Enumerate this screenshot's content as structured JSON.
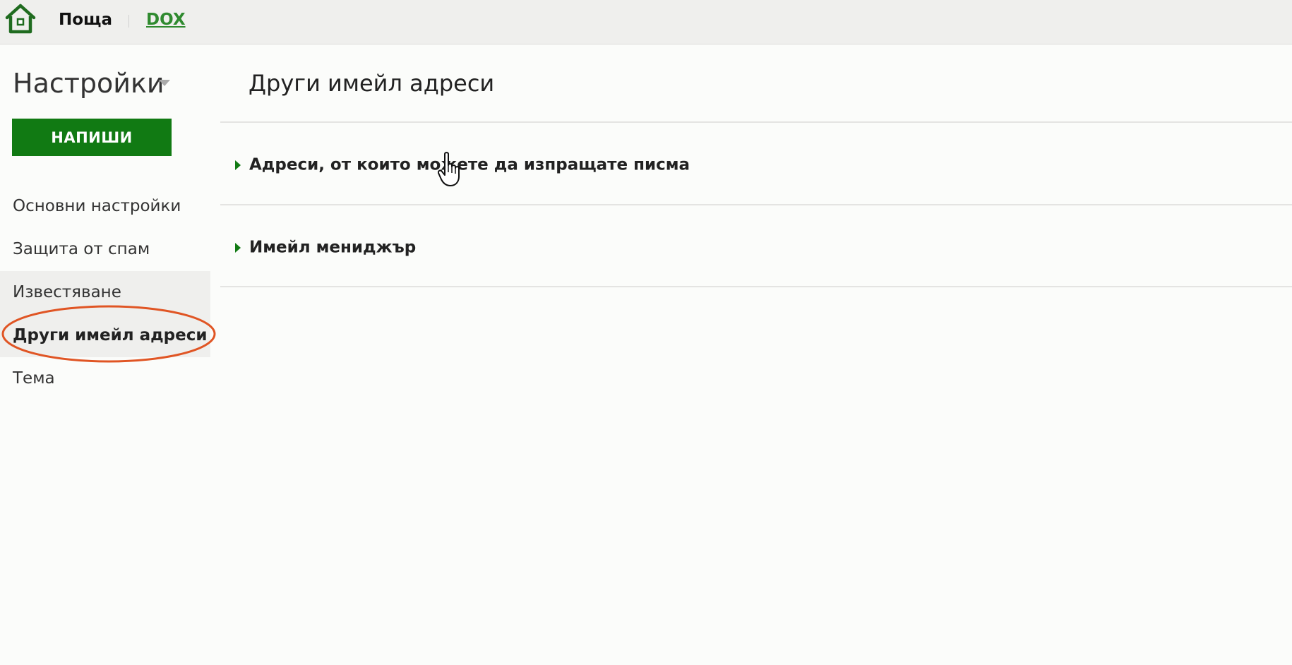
{
  "topbar": {
    "home_icon": "home-icon",
    "app_name": "Поща",
    "dox_link": "DOX"
  },
  "sidebar": {
    "settings_title": "Настройки",
    "compose_label": "НАПИШИ",
    "items": [
      {
        "label": "Основни настройки",
        "state": "normal"
      },
      {
        "label": "Защита от спам",
        "state": "normal"
      },
      {
        "label": "Известяване",
        "state": "shaded"
      },
      {
        "label": "Други имейл адреси",
        "state": "active"
      },
      {
        "label": "Тема",
        "state": "normal"
      }
    ]
  },
  "main": {
    "title": "Други имейл адреси",
    "sections": [
      {
        "label": "Адреси, от които можете да изпращате писма",
        "icon": "expand-arrow-icon"
      },
      {
        "label": "Имейл мениджър",
        "icon": "expand-arrow-icon"
      }
    ]
  },
  "colors": {
    "accent": "#117a13",
    "link": "#2f8a2f",
    "annotation": "#e05524"
  }
}
